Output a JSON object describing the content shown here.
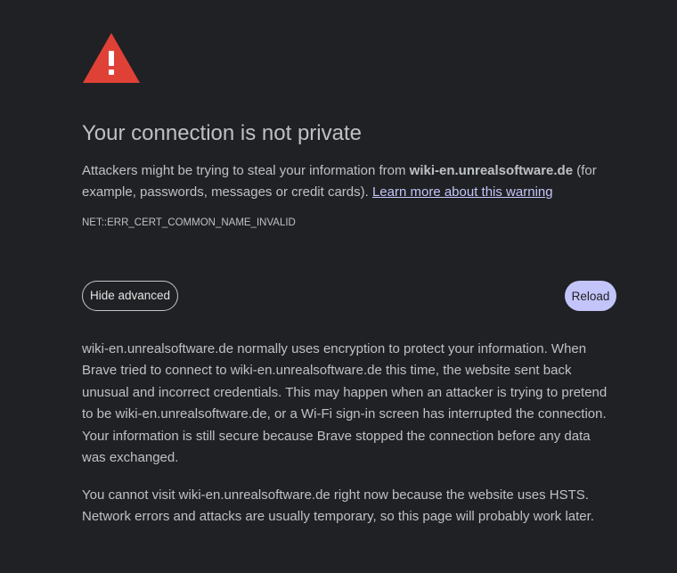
{
  "icon": {
    "name": "warning-triangle-icon",
    "color": "#e04137"
  },
  "main": {
    "title": "Your connection is not private",
    "intro_prefix": "Attackers might be trying to steal your information from ",
    "domain": "wiki-en.unrealsoftware.de",
    "intro_suffix": " (for example, passwords, messages or credit cards). ",
    "learn_more_link": "Learn more about this warning",
    "error_code": "NET::ERR_CERT_COMMON_NAME_INVALID"
  },
  "buttons": {
    "hide_advanced_label": "Hide advanced",
    "reload_label": "Reload"
  },
  "details": {
    "paragraph1": "wiki-en.unrealsoftware.de normally uses encryption to protect your information. When Brave tried to connect to wiki-en.unrealsoftware.de this time, the website sent back unusual and incorrect credentials. This may happen when an attacker is trying to pretend to be wiki-en.unrealsoftware.de, or a Wi-Fi sign-in screen has interrupted the connection. Your information is still secure because Brave stopped the connection before any data was exchanged.",
    "paragraph2": "You cannot visit wiki-en.unrealsoftware.de right now because the website uses HSTS. Network errors and attacks are usually temporary, so this page will probably work later."
  },
  "colors": {
    "background": "#202124",
    "text": "#bdc1c6",
    "accent": "#c3c5fa",
    "danger": "#e04137"
  }
}
